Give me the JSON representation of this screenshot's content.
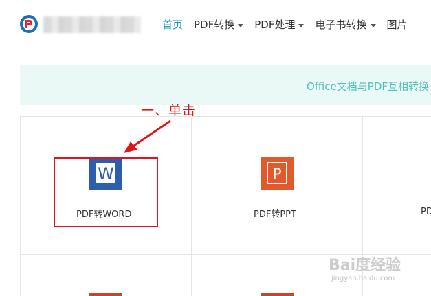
{
  "header": {
    "nav": [
      {
        "label": "首页",
        "active": true,
        "dropdown": false
      },
      {
        "label": "PDF转换",
        "active": false,
        "dropdown": true
      },
      {
        "label": "PDF处理",
        "active": false,
        "dropdown": true
      },
      {
        "label": "电子书转换",
        "active": false,
        "dropdown": true
      },
      {
        "label": "图片",
        "active": false,
        "dropdown": false
      }
    ]
  },
  "banner": {
    "text": "Office文档与PDF互相转换"
  },
  "annotation": {
    "text": "一、单击"
  },
  "tiles": [
    {
      "label": "PDF转WORD",
      "icon": "word-icon",
      "color": "#2b5fae",
      "letter": "W"
    },
    {
      "label": "PDF转PPT",
      "icon": "powerpoint-icon",
      "color": "#e3592b",
      "letter": "P"
    },
    {
      "label": "PD",
      "icon": "pdf-convert-icon"
    }
  ],
  "watermark": {
    "brand": "Bai度经验",
    "url": "jingyan.baidu.com"
  },
  "colors": {
    "accent": "#1d9ab0",
    "banner_text": "#4cc3b6",
    "annotation": "#e01515"
  }
}
